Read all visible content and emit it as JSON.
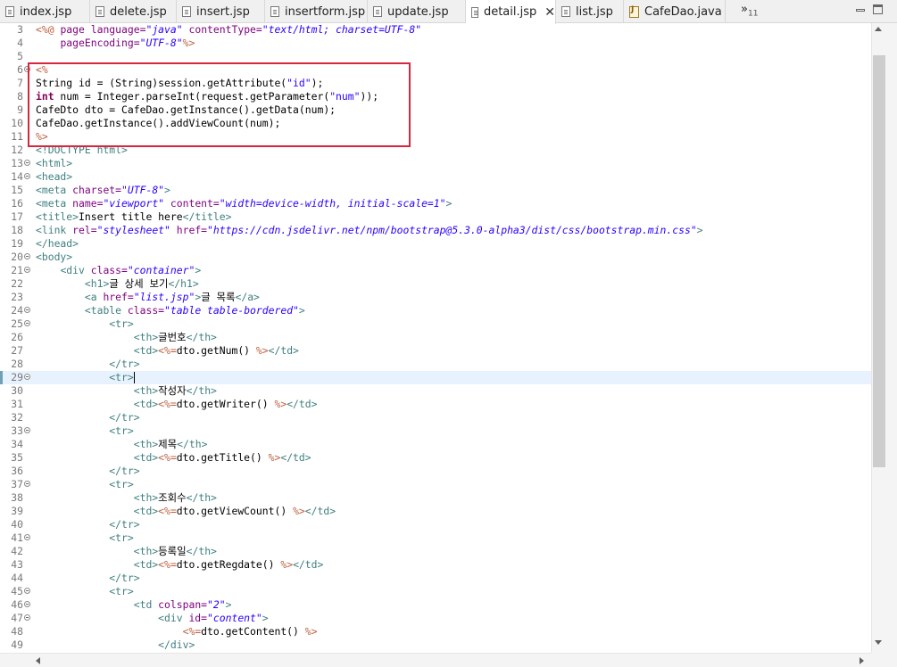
{
  "tabs": [
    {
      "label": "index.jsp",
      "icon": "jsp-file-icon",
      "active": false
    },
    {
      "label": "delete.jsp",
      "icon": "jsp-file-icon",
      "active": false
    },
    {
      "label": "insert.jsp",
      "icon": "jsp-file-icon",
      "active": false
    },
    {
      "label": "insertform.jsp",
      "icon": "jsp-file-icon",
      "active": false
    },
    {
      "label": "update.jsp",
      "icon": "jsp-file-icon",
      "active": false
    },
    {
      "label": "detail.jsp",
      "icon": "jsp-file-icon",
      "active": true,
      "close": "✕"
    },
    {
      "label": "list.jsp",
      "icon": "jsp-file-icon",
      "active": false
    },
    {
      "label": "CafeDao.java",
      "icon": "java-file-icon",
      "active": false
    }
  ],
  "overflow": {
    "label": "»",
    "count": "11"
  },
  "lines": [
    {
      "n": "3",
      "fold": false,
      "segs": [
        [
          "d",
          "<%@ "
        ],
        [
          "a",
          "page "
        ],
        [
          "a",
          "language="
        ],
        [
          "s",
          "\"java\""
        ],
        [
          "t",
          " "
        ],
        [
          "a",
          "contentType="
        ],
        [
          "s",
          "\"text/html; charset=UTF-8\""
        ]
      ]
    },
    {
      "n": "4",
      "fold": false,
      "segs": [
        [
          "t",
          "    "
        ],
        [
          "a",
          "pageEncoding="
        ],
        [
          "s",
          "\"UTF-8\""
        ],
        [
          "d",
          "%>"
        ]
      ]
    },
    {
      "n": "5",
      "fold": false,
      "segs": []
    },
    {
      "n": "6",
      "fold": true,
      "segs": [
        [
          "d",
          "<%"
        ]
      ]
    },
    {
      "n": "7",
      "fold": false,
      "segs": [
        [
          "t",
          "String id = (String)session.getAttribute("
        ],
        [
          "j",
          "\"id\""
        ],
        [
          "t",
          ");"
        ]
      ]
    },
    {
      "n": "8",
      "fold": false,
      "segs": [
        [
          "k",
          "int"
        ],
        [
          "t",
          " num = Integer.parseInt(request.getParameter("
        ],
        [
          "j",
          "\"num\""
        ],
        [
          "t",
          "));"
        ]
      ]
    },
    {
      "n": "9",
      "fold": false,
      "segs": [
        [
          "t",
          "CafeDto dto = CafeDao.getInstance().getData(num);"
        ]
      ]
    },
    {
      "n": "10",
      "fold": false,
      "segs": [
        [
          "t",
          "CafeDao.getInstance().addViewCount(num);"
        ]
      ]
    },
    {
      "n": "11",
      "fold": false,
      "segs": [
        [
          "d",
          "%>"
        ]
      ]
    },
    {
      "n": "12",
      "fold": false,
      "segs": [
        [
          "g",
          "<!DOCTYPE html>"
        ]
      ]
    },
    {
      "n": "13",
      "fold": true,
      "segs": [
        [
          "g",
          "<html>"
        ]
      ]
    },
    {
      "n": "14",
      "fold": true,
      "segs": [
        [
          "g",
          "<head>"
        ]
      ]
    },
    {
      "n": "15",
      "fold": false,
      "segs": [
        [
          "g",
          "<meta "
        ],
        [
          "a",
          "charset="
        ],
        [
          "s",
          "\"UTF-8\""
        ],
        [
          "g",
          ">"
        ]
      ]
    },
    {
      "n": "16",
      "fold": false,
      "segs": [
        [
          "g",
          "<meta "
        ],
        [
          "a",
          "name="
        ],
        [
          "s",
          "\"viewport\""
        ],
        [
          "t",
          " "
        ],
        [
          "a",
          "content="
        ],
        [
          "s",
          "\"width=device-width, initial-scale=1\""
        ],
        [
          "g",
          ">"
        ]
      ]
    },
    {
      "n": "17",
      "fold": false,
      "segs": [
        [
          "g",
          "<title>"
        ],
        [
          "t",
          "Insert title here"
        ],
        [
          "g",
          "</title>"
        ]
      ]
    },
    {
      "n": "18",
      "fold": false,
      "segs": [
        [
          "g",
          "<link "
        ],
        [
          "a",
          "rel="
        ],
        [
          "s",
          "\"stylesheet\""
        ],
        [
          "t",
          " "
        ],
        [
          "a",
          "href="
        ],
        [
          "s",
          "\"https://cdn.jsdelivr.net/npm/bootstrap@5.3.0-alpha3/dist/css/bootstrap.min.css\""
        ],
        [
          "g",
          ">"
        ]
      ]
    },
    {
      "n": "19",
      "fold": false,
      "segs": [
        [
          "g",
          "</head>"
        ]
      ]
    },
    {
      "n": "20",
      "fold": true,
      "segs": [
        [
          "g",
          "<body>"
        ]
      ]
    },
    {
      "n": "21",
      "fold": true,
      "segs": [
        [
          "t",
          "    "
        ],
        [
          "g",
          "<div "
        ],
        [
          "a",
          "class="
        ],
        [
          "s",
          "\"container\""
        ],
        [
          "g",
          ">"
        ]
      ]
    },
    {
      "n": "22",
      "fold": false,
      "segs": [
        [
          "t",
          "        "
        ],
        [
          "g",
          "<h1>"
        ],
        [
          "t",
          "글 상세 보기"
        ],
        [
          "g",
          "</h1>"
        ]
      ]
    },
    {
      "n": "23",
      "fold": false,
      "segs": [
        [
          "t",
          "        "
        ],
        [
          "g",
          "<a "
        ],
        [
          "a",
          "href="
        ],
        [
          "s",
          "\"list.jsp\""
        ],
        [
          "g",
          ">"
        ],
        [
          "t",
          "글 목록"
        ],
        [
          "g",
          "</a>"
        ]
      ]
    },
    {
      "n": "24",
      "fold": true,
      "segs": [
        [
          "t",
          "        "
        ],
        [
          "g",
          "<table "
        ],
        [
          "a",
          "class="
        ],
        [
          "s",
          "\"table table-bordered\""
        ],
        [
          "g",
          ">"
        ]
      ]
    },
    {
      "n": "25",
      "fold": true,
      "segs": [
        [
          "t",
          "            "
        ],
        [
          "g",
          "<tr>"
        ]
      ]
    },
    {
      "n": "26",
      "fold": false,
      "segs": [
        [
          "t",
          "                "
        ],
        [
          "g",
          "<th>"
        ],
        [
          "t",
          "글번호"
        ],
        [
          "g",
          "</th>"
        ]
      ]
    },
    {
      "n": "27",
      "fold": false,
      "segs": [
        [
          "t",
          "                "
        ],
        [
          "g",
          "<td>"
        ],
        [
          "d",
          "<%="
        ],
        [
          "t",
          "dto.getNum() "
        ],
        [
          "d",
          "%>"
        ],
        [
          "g",
          "</td>"
        ]
      ]
    },
    {
      "n": "28",
      "fold": false,
      "segs": [
        [
          "t",
          "            "
        ],
        [
          "g",
          "</tr>"
        ]
      ]
    },
    {
      "n": "29",
      "fold": true,
      "current": true,
      "segs": [
        [
          "t",
          "            "
        ],
        [
          "g",
          "<tr>"
        ],
        [
          "c",
          ""
        ]
      ]
    },
    {
      "n": "30",
      "fold": false,
      "segs": [
        [
          "t",
          "                "
        ],
        [
          "g",
          "<th>"
        ],
        [
          "t",
          "작성자"
        ],
        [
          "g",
          "</th>"
        ]
      ]
    },
    {
      "n": "31",
      "fold": false,
      "segs": [
        [
          "t",
          "                "
        ],
        [
          "g",
          "<td>"
        ],
        [
          "d",
          "<%="
        ],
        [
          "t",
          "dto.getWriter() "
        ],
        [
          "d",
          "%>"
        ],
        [
          "g",
          "</td>"
        ]
      ]
    },
    {
      "n": "32",
      "fold": false,
      "segs": [
        [
          "t",
          "            "
        ],
        [
          "g",
          "</tr>"
        ]
      ]
    },
    {
      "n": "33",
      "fold": true,
      "segs": [
        [
          "t",
          "            "
        ],
        [
          "g",
          "<tr>"
        ]
      ]
    },
    {
      "n": "34",
      "fold": false,
      "segs": [
        [
          "t",
          "                "
        ],
        [
          "g",
          "<th>"
        ],
        [
          "t",
          "제목"
        ],
        [
          "g",
          "</th>"
        ]
      ]
    },
    {
      "n": "35",
      "fold": false,
      "segs": [
        [
          "t",
          "                "
        ],
        [
          "g",
          "<td>"
        ],
        [
          "d",
          "<%="
        ],
        [
          "t",
          "dto.getTitle() "
        ],
        [
          "d",
          "%>"
        ],
        [
          "g",
          "</td>"
        ]
      ]
    },
    {
      "n": "36",
      "fold": false,
      "segs": [
        [
          "t",
          "            "
        ],
        [
          "g",
          "</tr>"
        ]
      ]
    },
    {
      "n": "37",
      "fold": true,
      "segs": [
        [
          "t",
          "            "
        ],
        [
          "g",
          "<tr>"
        ]
      ]
    },
    {
      "n": "38",
      "fold": false,
      "segs": [
        [
          "t",
          "                "
        ],
        [
          "g",
          "<th>"
        ],
        [
          "t",
          "조회수"
        ],
        [
          "g",
          "</th>"
        ]
      ]
    },
    {
      "n": "39",
      "fold": false,
      "segs": [
        [
          "t",
          "                "
        ],
        [
          "g",
          "<td>"
        ],
        [
          "d",
          "<%="
        ],
        [
          "t",
          "dto.getViewCount() "
        ],
        [
          "d",
          "%>"
        ],
        [
          "g",
          "</td>"
        ]
      ]
    },
    {
      "n": "40",
      "fold": false,
      "segs": [
        [
          "t",
          "            "
        ],
        [
          "g",
          "</tr>"
        ]
      ]
    },
    {
      "n": "41",
      "fold": true,
      "segs": [
        [
          "t",
          "            "
        ],
        [
          "g",
          "<tr>"
        ]
      ]
    },
    {
      "n": "42",
      "fold": false,
      "segs": [
        [
          "t",
          "                "
        ],
        [
          "g",
          "<th>"
        ],
        [
          "t",
          "등록일"
        ],
        [
          "g",
          "</th>"
        ]
      ]
    },
    {
      "n": "43",
      "fold": false,
      "segs": [
        [
          "t",
          "                "
        ],
        [
          "g",
          "<td>"
        ],
        [
          "d",
          "<%="
        ],
        [
          "t",
          "dto.getRegdate() "
        ],
        [
          "d",
          "%>"
        ],
        [
          "g",
          "</td>"
        ]
      ]
    },
    {
      "n": "44",
      "fold": false,
      "segs": [
        [
          "t",
          "            "
        ],
        [
          "g",
          "</tr>"
        ]
      ]
    },
    {
      "n": "45",
      "fold": true,
      "segs": [
        [
          "t",
          "            "
        ],
        [
          "g",
          "<tr>"
        ]
      ]
    },
    {
      "n": "46",
      "fold": true,
      "segs": [
        [
          "t",
          "                "
        ],
        [
          "g",
          "<td "
        ],
        [
          "a",
          "colspan="
        ],
        [
          "s",
          "\"2\""
        ],
        [
          "g",
          ">"
        ]
      ]
    },
    {
      "n": "47",
      "fold": true,
      "segs": [
        [
          "t",
          "                    "
        ],
        [
          "g",
          "<div "
        ],
        [
          "a",
          "id="
        ],
        [
          "s",
          "\"content\""
        ],
        [
          "g",
          ">"
        ]
      ]
    },
    {
      "n": "48",
      "fold": false,
      "segs": [
        [
          "t",
          "                        "
        ],
        [
          "d",
          "<%="
        ],
        [
          "t",
          "dto.getContent() "
        ],
        [
          "d",
          "%>"
        ]
      ]
    },
    {
      "n": "49",
      "fold": false,
      "segs": [
        [
          "t",
          "                    "
        ],
        [
          "g",
          "</div>"
        ]
      ]
    }
  ]
}
